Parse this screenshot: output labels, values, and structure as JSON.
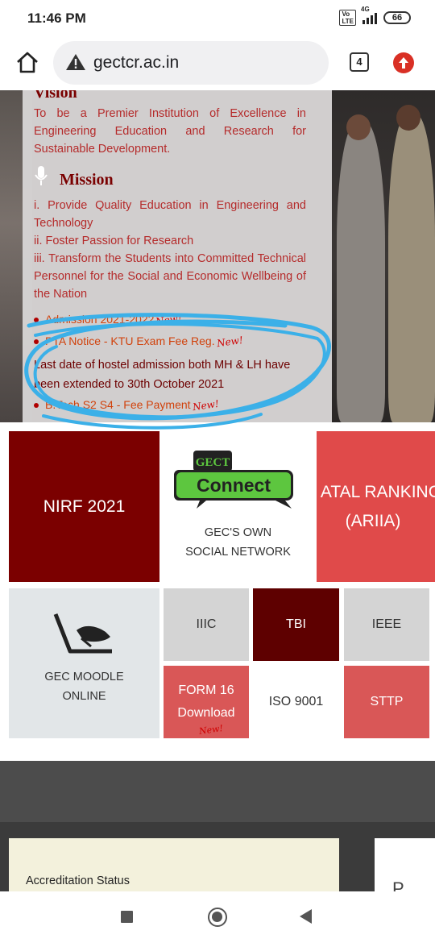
{
  "status_bar": {
    "time": "11:46 PM",
    "volte": "Vo LTE",
    "network": "4G",
    "battery": "66"
  },
  "browser": {
    "url": "gectcr.ac.in",
    "tab_count": "4",
    "icons": {
      "home": "home-icon",
      "security": "warning-icon",
      "update": "update-arrow-icon"
    }
  },
  "hero": {
    "vision_title": "Vision",
    "vision_text": "To be a Premier Institution of Excellence in Engineering Education and Research for Sustainable Development.",
    "mission_title": "Mission",
    "mission_items": [
      "i. Provide Quality Education in Engineering and Technology",
      "ii. Foster Passion for Research",
      "iii. Transform the Students into Committed Technical Personnel for the Social and Economic Wellbeing of the Nation"
    ],
    "notices": [
      {
        "text": "Admission 2021-2022",
        "new": "New!"
      },
      {
        "text": "PTA Notice - KTU Exam Fee Reg.",
        "new": "New!"
      },
      {
        "text": "Last date of hostel admission both MH & LH have been extended to 30th October 2021"
      },
      {
        "text": "B.Tech S2 S4 - Fee Payment",
        "new": "New!"
      }
    ]
  },
  "tiles": {
    "nirf": "NIRF 2021",
    "connect_badge": "GECT",
    "connect_title": "Connect",
    "connect_sub1": "GEC'S OWN",
    "connect_sub2": "SOCIAL NETWORK",
    "atal_line1": "ATAL RANKING",
    "atal_line2": "(ARIIA)",
    "moodle_line1": "GEC MOODLE",
    "moodle_line2": "ONLINE",
    "iiic": "IIIC",
    "tbi": "TBI",
    "ieee": "IEEE",
    "form16_line1": "FORM 16",
    "form16_line2": "Download",
    "form16_new": "New!",
    "iso": "ISO 9001",
    "sttp": "STTP"
  },
  "footer": {
    "accreditation": "Accreditation Status",
    "right_card": "P"
  },
  "colors": {
    "maroon": "#7b0000",
    "dark_maroon": "#5e0000",
    "red": "#e04a4a",
    "light_red": "#d95757",
    "text_red": "#b52b2b",
    "scribble": "#3bb0e8",
    "connect_green": "#5dc63f"
  }
}
